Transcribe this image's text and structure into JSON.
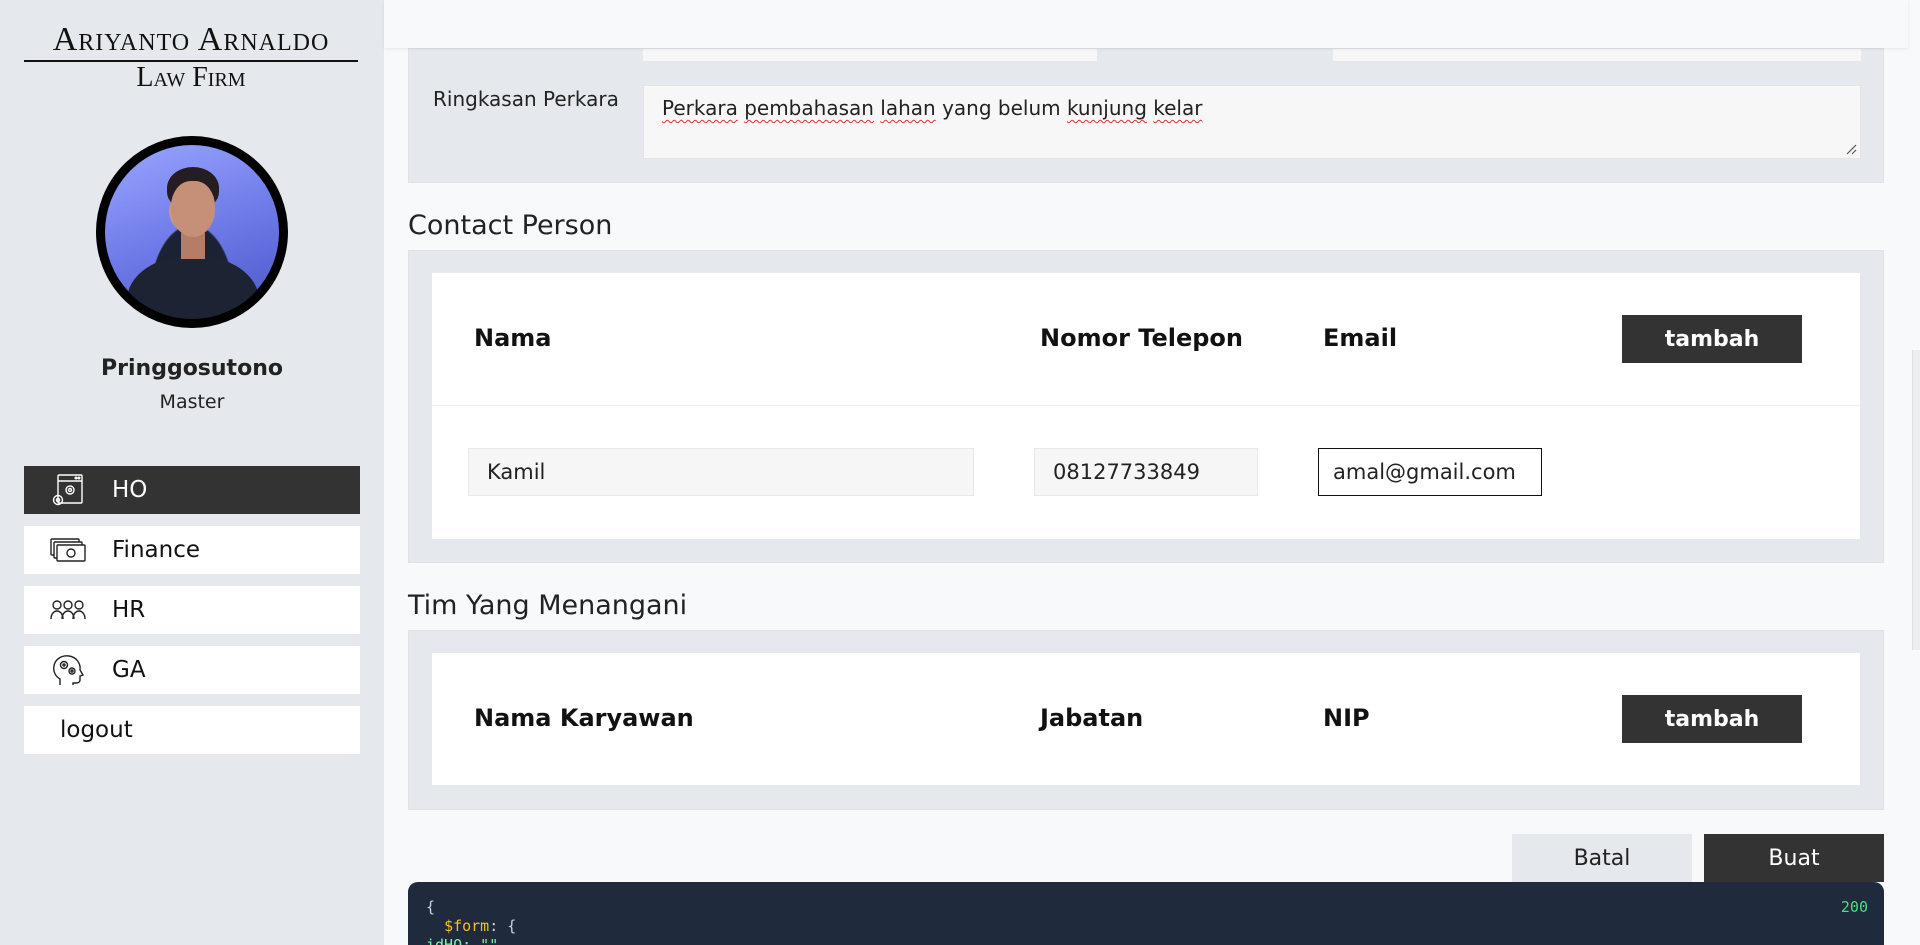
{
  "brand": {
    "line1": "Ariyanto Arnaldo",
    "line2": "Law Firm"
  },
  "user": {
    "name": "Pringgosutono",
    "role": "Master"
  },
  "nav": {
    "items": [
      {
        "label": "HO",
        "icon": "admin-settings-icon",
        "active": true
      },
      {
        "label": "Finance",
        "icon": "money-icon",
        "active": false
      },
      {
        "label": "HR",
        "icon": "people-icon",
        "active": false
      },
      {
        "label": "GA",
        "icon": "head-gears-icon",
        "active": false
      }
    ],
    "logout": "logout"
  },
  "ringkasan": {
    "label": "Ringkasan Perkara",
    "value_words": [
      "Perkara",
      "pembahasan",
      "lahan",
      "yang",
      "belum",
      "kunjung",
      "kelar"
    ]
  },
  "contact": {
    "title": "Contact Person",
    "headers": {
      "name": "Nama",
      "phone": "Nomor Telepon",
      "email": "Email"
    },
    "add_label": "tambah",
    "rows": [
      {
        "name": "Kamil",
        "phone": "08127733849",
        "email": "amal@gmail.com"
      }
    ]
  },
  "team": {
    "title": "Tim Yang Menangani",
    "headers": {
      "name": "Nama Karyawan",
      "position": "Jabatan",
      "nip": "NIP"
    },
    "add_label": "tambah"
  },
  "actions": {
    "cancel": "Batal",
    "submit": "Buat"
  },
  "debug": {
    "status": "200",
    "line1": "{",
    "key": "$form",
    "line2_rest": ": {",
    "line3": "  idHO: \"\""
  },
  "colors": {
    "dark": "#333333",
    "panel": "#e5e8ec",
    "code_bg": "#1f2a3c",
    "status_green": "#4ade80"
  }
}
